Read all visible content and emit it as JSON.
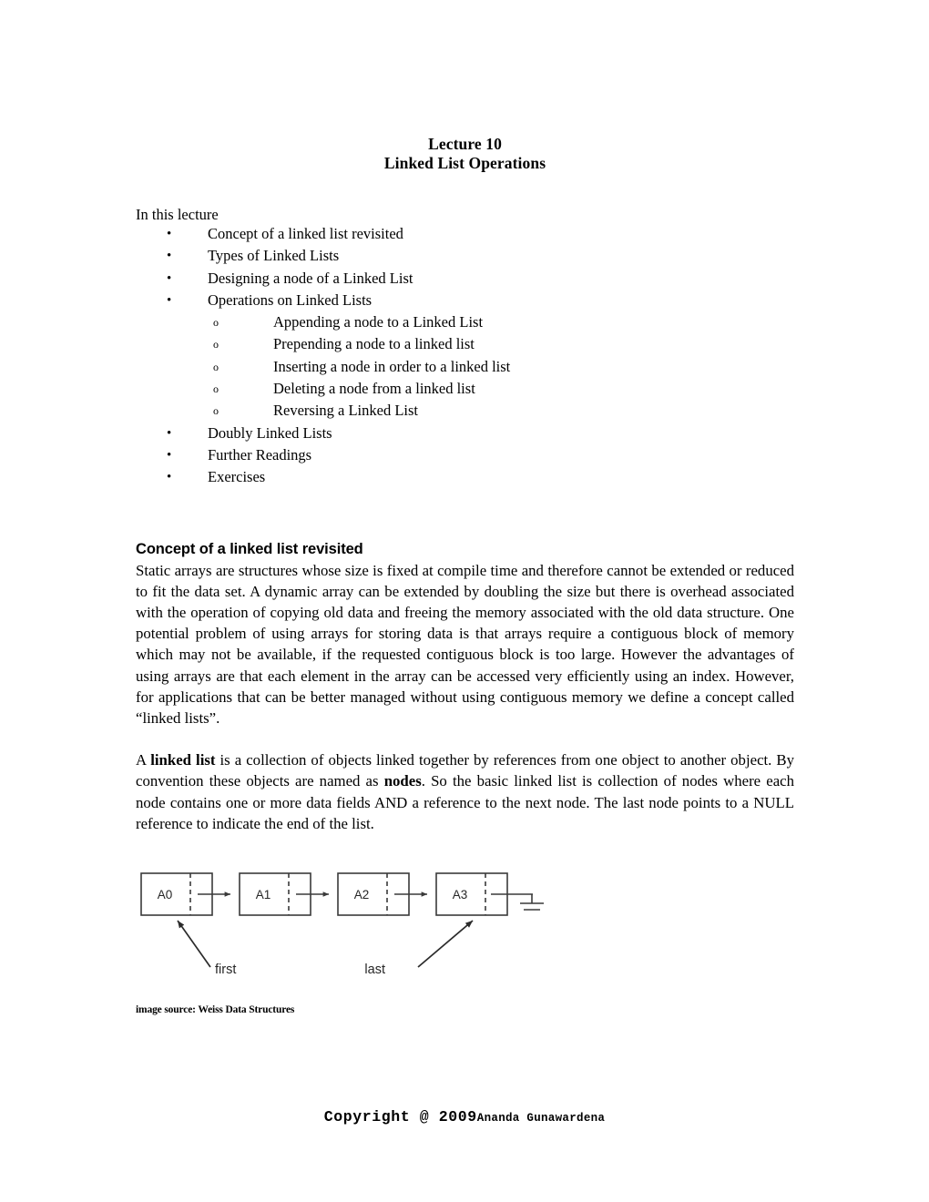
{
  "document": {
    "title_line_1": "Lecture 10",
    "title_line_2": "Linked List Operations",
    "intro_line": "In this lecture"
  },
  "outline": {
    "items": [
      {
        "label": "Concept of a linked list revisited"
      },
      {
        "label": "Types of Linked Lists"
      },
      {
        "label": "Designing a node of a Linked List"
      },
      {
        "label": "Operations on Linked Lists",
        "children": [
          {
            "label": "Appending a node to a Linked List"
          },
          {
            "label": "Prepending a node to a linked list"
          },
          {
            "label": "Inserting a node in order to a linked list"
          },
          {
            "label": "Deleting a node from a linked list"
          },
          {
            "label": "Reversing a Linked List"
          }
        ]
      },
      {
        "label": "Doubly Linked Lists"
      },
      {
        "label": "Further Readings"
      },
      {
        "label": "Exercises"
      }
    ],
    "bullet_glyph": "•",
    "sub_bullet_glyph": "o"
  },
  "section": {
    "heading": "Concept of a linked list revisited",
    "paragraph_1": "Static arrays are structures whose size is fixed at compile time and therefore cannot be extended or reduced to fit the data set. A dynamic array can be extended by doubling the size but there is overhead associated with the operation of copying old data and freeing the memory associated with the old data structure. One potential problem of using arrays for storing data is that arrays require a contiguous block of memory which may not be available, if the requested contiguous block is too large. However the advantages of using arrays are that each element in the array can be accessed very efficiently using an index. However, for applications that can be better managed without using contiguous memory we define a concept called “linked lists”.",
    "paragraph_2": {
      "part_1": "A ",
      "bold_1": "linked list",
      "part_2": " is a collection of objects linked together by references from one object to another object. By convention these objects are named as ",
      "bold_2": "nodes",
      "part_3": ". So the basic linked list is collection of nodes where each node contains one or more data fields AND a reference to the next node. The last node points to a NULL reference to indicate the end of the list."
    }
  },
  "diagram": {
    "nodes": [
      {
        "label": "A0"
      },
      {
        "label": "A1"
      },
      {
        "label": "A2"
      },
      {
        "label": "A3"
      }
    ],
    "pointer_first_label": "first",
    "pointer_last_label": "last",
    "terminator": "null-ground-symbol",
    "stroke_color": "#3a3a3a",
    "label_color": "#262626"
  },
  "caption": "image source: Weiss Data Structures",
  "footer": {
    "copyright": "Copyright @ 2009",
    "author": "Ananda Gunawardena"
  }
}
